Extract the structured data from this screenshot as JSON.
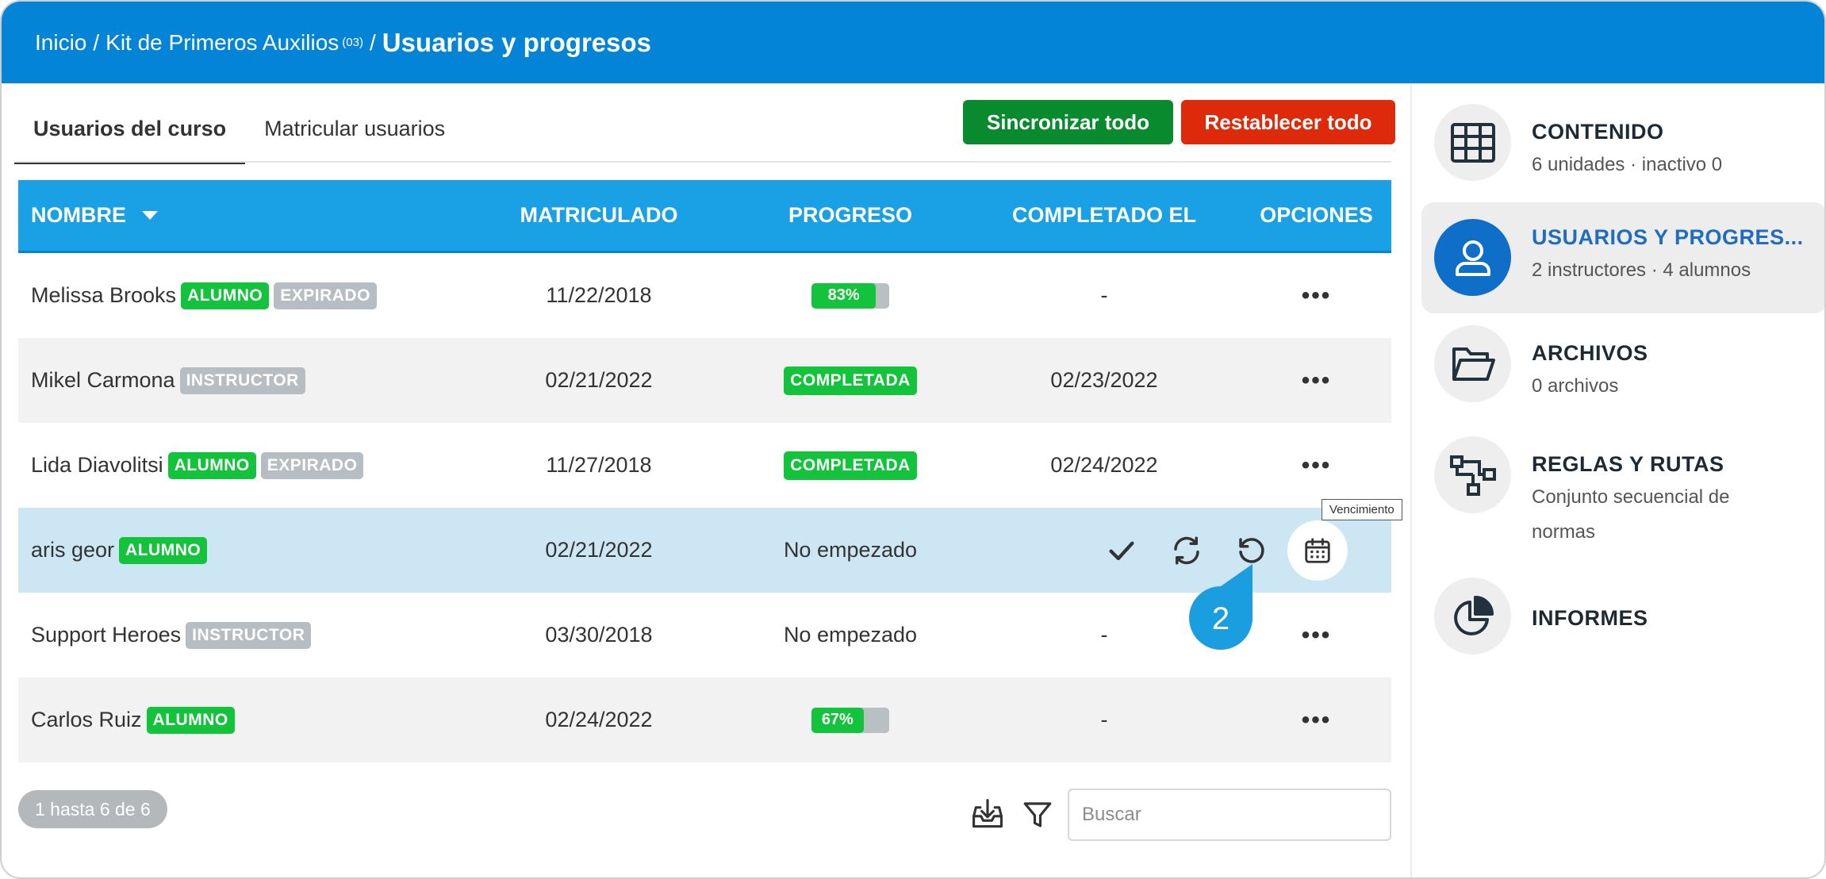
{
  "breadcrumb": {
    "home": "Inicio",
    "sep1": "/",
    "course": "Kit de Primeros Auxilios",
    "course_code": "(03)",
    "sep2": "/",
    "current": "Usuarios y progresos"
  },
  "tabs": [
    {
      "label": "Usuarios del curso",
      "active": true
    },
    {
      "label": "Matricular usuarios",
      "active": false
    }
  ],
  "buttons": {
    "sync": "Sincronizar todo",
    "reset": "Restablecer todo"
  },
  "colors": {
    "header": "#0384d6",
    "table_header": "#1aa0e4",
    "sync_button": "#0a8a2e",
    "reset_button": "#dc2a0a",
    "badge_green": "#13c33b",
    "badge_grey": "#b6bec3",
    "highlight_row": "#cde6f3"
  },
  "table": {
    "headers": {
      "name": "NOMBRE",
      "enrolled": "MATRICULADO",
      "progress": "PROGRESO",
      "completed": "COMPLETADO EL",
      "options": "OPCIONES"
    },
    "rows": [
      {
        "name": "Melissa Brooks",
        "role": "ALUMNO",
        "expired": "EXPIRADO",
        "enrolled": "11/22/2018",
        "progress_label": "83%",
        "progress_fraction": 0.83,
        "completed": "-"
      },
      {
        "name": "Mikel Carmona",
        "role": "INSTRUCTOR",
        "enrolled": "02/21/2022",
        "status": "COMPLETADA",
        "completed": "02/23/2022"
      },
      {
        "name": "Lida Diavolitsi",
        "role": "ALUMNO",
        "expired": "EXPIRADO",
        "enrolled": "11/27/2018",
        "status": "COMPLETADA",
        "completed": "02/24/2022"
      },
      {
        "name": "aris geor",
        "role": "ALUMNO",
        "enrolled": "02/21/2022",
        "progress_text": "No empezado"
      },
      {
        "name": "Support Heroes",
        "role": "INSTRUCTOR",
        "enrolled": "03/30/2018",
        "progress_text": "No empezado",
        "completed": "-"
      },
      {
        "name": "Carlos Ruiz",
        "role": "ALUMNO",
        "enrolled": "02/24/2022",
        "progress_label": "67%",
        "progress_fraction": 0.67,
        "completed": "-"
      }
    ],
    "options_glyph": "•••",
    "row_actions": [
      "check-icon",
      "sync-icon",
      "reset-icon",
      "calendar-icon"
    ]
  },
  "tooltip": "Vencimiento",
  "marker_number": "2",
  "footer": {
    "pagination": "1 hasta 6 de 6",
    "search_placeholder": "Buscar",
    "icons": [
      "download-icon",
      "filter-icon"
    ]
  },
  "sidebar": [
    {
      "title": "CONTENIDO",
      "sub": "6 unidades · inactivo 0",
      "icon": "grid-icon"
    },
    {
      "title": "USUARIOS Y PROGRES...",
      "sub": "2 instructores · 4 alumnos",
      "icon": "user-icon",
      "active": true
    },
    {
      "title": "ARCHIVOS",
      "sub": "0 archivos",
      "icon": "folder-icon"
    },
    {
      "title": "REGLAS Y RUTAS",
      "sub": "Conjunto secuencial de normas",
      "icon": "path-icon"
    },
    {
      "title": "INFORMES",
      "sub": "",
      "icon": "pie-chart-icon"
    }
  ]
}
